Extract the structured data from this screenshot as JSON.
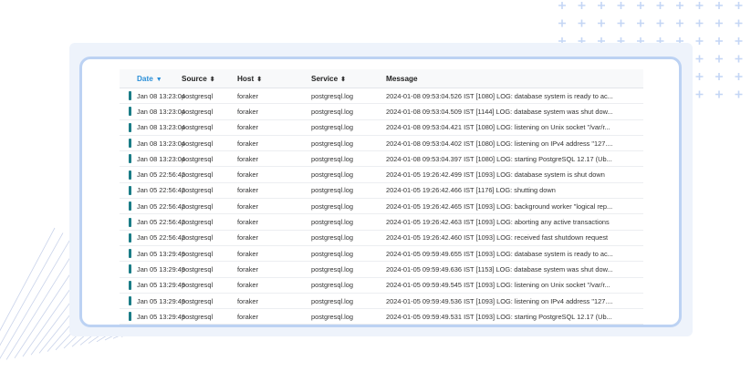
{
  "table": {
    "columns": [
      {
        "label": "Date",
        "sort_icon": "▼"
      },
      {
        "label": "Source",
        "sort_icon": "⬍"
      },
      {
        "label": "Host",
        "sort_icon": "⬍"
      },
      {
        "label": "Service",
        "sort_icon": "⬍"
      },
      {
        "label": "Message",
        "sort_icon": ""
      }
    ],
    "rows": [
      {
        "date": "Jan 08 13:23:04",
        "source": "postgresql",
        "host": "foraker",
        "service": "postgresql.log",
        "message": "2024-01-08 09:53:04.526 IST [1080] LOG: database system is ready to ac..."
      },
      {
        "date": "Jan 08 13:23:04",
        "source": "postgresql",
        "host": "foraker",
        "service": "postgresql.log",
        "message": "2024-01-08 09:53:04.509 IST [1144] LOG: database system was shut dow..."
      },
      {
        "date": "Jan 08 13:23:04",
        "source": "postgresql",
        "host": "foraker",
        "service": "postgresql.log",
        "message": "2024-01-08 09:53:04.421 IST [1080] LOG: listening on Unix socket \"/var/r..."
      },
      {
        "date": "Jan 08 13:23:04",
        "source": "postgresql",
        "host": "foraker",
        "service": "postgresql.log",
        "message": "2024-01-08 09:53:04.402 IST [1080] LOG: listening on IPv4 address \"127...."
      },
      {
        "date": "Jan 08 13:23:04",
        "source": "postgresql",
        "host": "foraker",
        "service": "postgresql.log",
        "message": "2024-01-08 09:53:04.397 IST [1080] LOG: starting PostgreSQL 12.17 (Ub..."
      },
      {
        "date": "Jan 05 22:56:42",
        "source": "postgresql",
        "host": "foraker",
        "service": "postgresql.log",
        "message": "2024-01-05 19:26:42.499 IST [1093] LOG: database system is shut down"
      },
      {
        "date": "Jan 05 22:56:42",
        "source": "postgresql",
        "host": "foraker",
        "service": "postgresql.log",
        "message": "2024-01-05 19:26:42.466 IST [1176] LOG: shutting down"
      },
      {
        "date": "Jan 05 22:56:42",
        "source": "postgresql",
        "host": "foraker",
        "service": "postgresql.log",
        "message": "2024-01-05 19:26:42.465 IST [1093] LOG: background worker \"logical rep..."
      },
      {
        "date": "Jan 05 22:56:42",
        "source": "postgresql",
        "host": "foraker",
        "service": "postgresql.log",
        "message": "2024-01-05 19:26:42.463 IST [1093] LOG: aborting any active transactions"
      },
      {
        "date": "Jan 05 22:56:42",
        "source": "postgresql",
        "host": "foraker",
        "service": "postgresql.log",
        "message": "2024-01-05 19:26:42.460 IST [1093] LOG: received fast shutdown request"
      },
      {
        "date": "Jan 05 13:29:49",
        "source": "postgresql",
        "host": "foraker",
        "service": "postgresql.log",
        "message": "2024-01-05 09:59:49.655 IST [1093] LOG: database system is ready to ac..."
      },
      {
        "date": "Jan 05 13:29:49",
        "source": "postgresql",
        "host": "foraker",
        "service": "postgresql.log",
        "message": "2024-01-05 09:59:49.636 IST [1153] LOG: database system was shut dow..."
      },
      {
        "date": "Jan 05 13:29:49",
        "source": "postgresql",
        "host": "foraker",
        "service": "postgresql.log",
        "message": "2024-01-05 09:59:49.545 IST [1093] LOG: listening on Unix socket \"/var/r..."
      },
      {
        "date": "Jan 05 13:29:49",
        "source": "postgresql",
        "host": "foraker",
        "service": "postgresql.log",
        "message": "2024-01-05 09:59:49.536 IST [1093] LOG: listening on IPv4 address \"127...."
      },
      {
        "date": "Jan 05 13:29:49",
        "source": "postgresql",
        "host": "foraker",
        "service": "postgresql.log",
        "message": "2024-01-05 09:59:49.531 IST [1093] LOG: starting PostgreSQL 12.17 (Ub..."
      }
    ]
  },
  "colors": {
    "accent": "#2a8fd8",
    "row_marker": "#1b7d87",
    "plus_decoration": "#c4d6f5",
    "line_decoration": "#c9d3ea"
  }
}
